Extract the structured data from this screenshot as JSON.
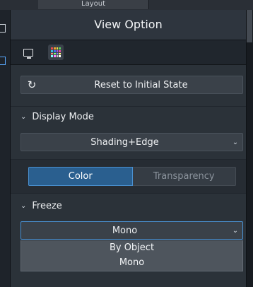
{
  "topbar": {
    "tab_label": "Layout"
  },
  "panel": {
    "title": "View Option",
    "toolbar": {
      "tools": [
        "monitor-icon",
        "color-grid-icon"
      ]
    },
    "reset_button": {
      "label": "Reset to Initial State",
      "icon": "refresh-icon"
    },
    "display_mode": {
      "title": "Display Mode",
      "selected": "Shading+Edge"
    },
    "color_tabs": {
      "options": [
        "Color",
        "Transparency"
      ],
      "selected": "Color"
    },
    "freeze": {
      "title": "Freeze",
      "selected": "Mono",
      "options": [
        "By Object",
        "Mono"
      ]
    }
  },
  "colors": {
    "accent": "#2a5f8f",
    "panel_bg": "#20262d",
    "section_bg": "#2b3239"
  }
}
